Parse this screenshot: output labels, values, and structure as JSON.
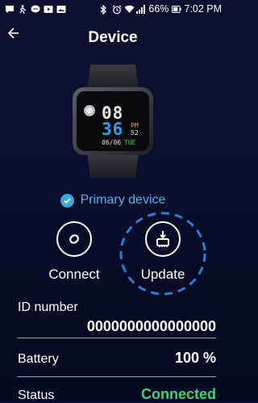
{
  "status_bar": {
    "battery": "66%",
    "time": "7:02 PM"
  },
  "app_bar": {
    "title": "Device"
  },
  "watch_face": {
    "hour": "08",
    "minute": "36",
    "ampm": "PM",
    "seconds": "52",
    "date": "06/06",
    "weekday": "TUE"
  },
  "primary": {
    "label": "Primary device"
  },
  "actions": {
    "connect": "Connect",
    "update": "Update"
  },
  "info": {
    "id_label": "ID number",
    "id_value": "0000000000000000",
    "battery_label": "Battery",
    "battery_value": "100 %",
    "status_label": "Status",
    "status_value": "Connected"
  },
  "colors": {
    "accent": "#39a8e0",
    "connected": "#43d27a"
  }
}
